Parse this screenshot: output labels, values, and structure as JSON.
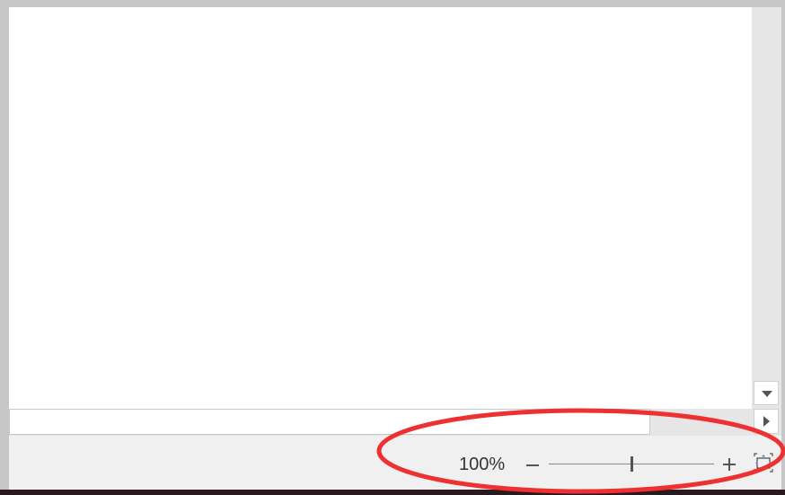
{
  "statusbar": {
    "zoom_level_text": "100%",
    "zoom_percent": 100,
    "zoom_slider_position": 0.5
  },
  "icons": {
    "scroll_down": "triangle-down-icon",
    "scroll_right": "triangle-right-icon",
    "zoom_out": "minus-icon",
    "zoom_in": "plus-icon",
    "fit_to_window": "fit-slide-icon"
  },
  "colors": {
    "annotation_circle": "#ee3030",
    "canvas": "#ffffff",
    "statusbar": "#f0f0f0"
  }
}
